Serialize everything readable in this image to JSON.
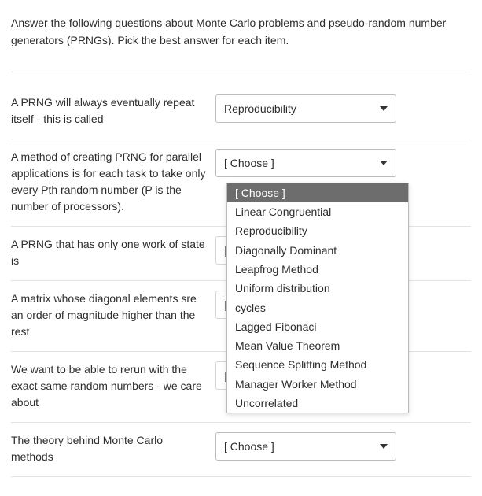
{
  "intro": "Answer the following questions about Monte Carlo problems and pseudo-random number generators (PRNGs).  Pick the best answer for each item.",
  "rows": [
    {
      "prompt": "A PRNG will always eventually repeat itself - this is called",
      "selected": "Reproducibility"
    },
    {
      "prompt": "A method of creating PRNG for parallel applications is for each task to take only every Pth random number (P is the number of processors).",
      "selected": "[ Choose ]"
    },
    {
      "prompt": "A PRNG that has only one work of state is",
      "selected": "[ Choose ]"
    },
    {
      "prompt": "A matrix whose diagonal elements sre an order of magnitude higher than the rest",
      "selected": "[ Choose ]"
    },
    {
      "prompt": "We want to be able to rerun with the exact same random numbers - we care about",
      "selected": "[ Choose ]"
    },
    {
      "prompt": "The theory behind Monte Carlo methods",
      "selected": "[ Choose ]"
    }
  ],
  "dropdown": {
    "highlighted": "[ Choose ]",
    "options": [
      "Linear Congruential",
      "Reproducibility",
      "Diagonally Dominant",
      "Leapfrog Method",
      "Uniform distribution",
      "cycles",
      "Lagged Fibonaci",
      "Mean Value Theorem",
      "Sequence Splitting Method",
      "Manager Worker Method",
      "Uncorrelated"
    ]
  }
}
